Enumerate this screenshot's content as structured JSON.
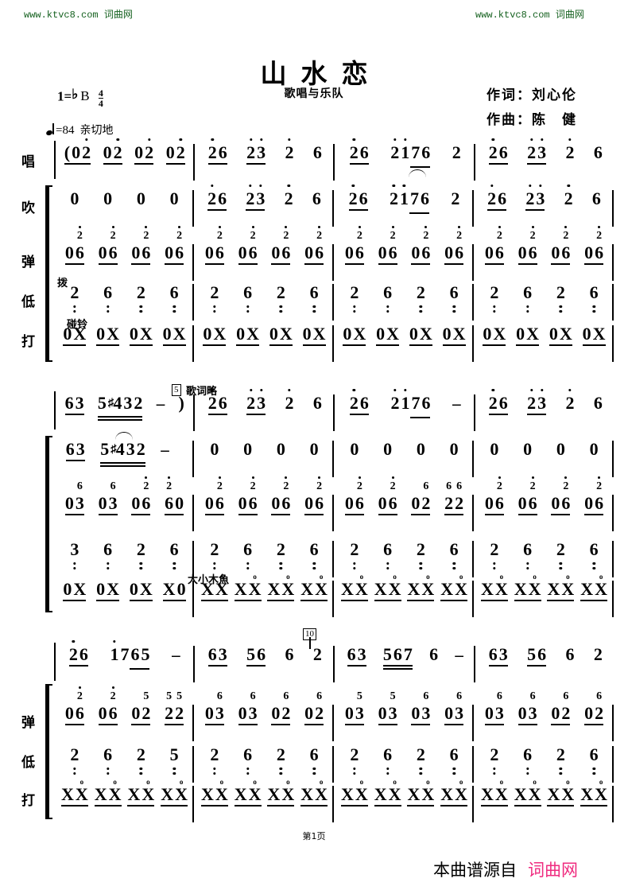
{
  "watermark": {
    "left": "www.ktvc8.com 词曲网",
    "right": "www.ktvc8.com 词曲网",
    "color": "#15611f"
  },
  "header": {
    "title": "山水恋",
    "subtitle": "歌唱与乐队",
    "lyricist": "作词：刘心伦",
    "composer": "作曲：陈　健"
  },
  "score_meta": {
    "key_prefix": "1=",
    "key_flat": "♭",
    "key_note": "B",
    "time_numerator": "4",
    "time_denominator": "4",
    "tempo_equals": "=84",
    "expression": "亲切地"
  },
  "staff_labels": {
    "sing": "唱",
    "blow": "吹",
    "pluck": "弹",
    "bass": "低",
    "perc": "打"
  },
  "annotations": {
    "bo": "拨",
    "pengling": "碰铃",
    "muyu": "大小木魚",
    "lyrics_omitted": "歌词略",
    "measure_5": "5",
    "measure_10": "10"
  },
  "footer": {
    "page": "第1页",
    "source_prefix": "本曲谱源自",
    "source_site": "词曲网",
    "source_color": "#ef2b7f"
  },
  "chart_data": {
    "type": "table",
    "title": "山水恋 — 简谱 (numbered musical notation)",
    "systems": [
      {
        "index": 1,
        "staves": [
          {
            "label": "唱",
            "measures": [
              "( 0 2· 0 2· 0 2· 0 2·",
              "2· 6 2· 3· 2· 6",
              "2· 6 2· 1· 7 6 2",
              "2· 6 2· 3· 2· 6"
            ]
          },
          {
            "label": "吹",
            "measures": [
              "0 0 0 0",
              "2· 6 2· 3· 2· 6",
              "2· 6 2· 1· 7 6 2",
              "2· 6 2· 3· 2· 6"
            ]
          },
          {
            "label": "弹",
            "measures": [
              "06 06 06 06 (上声部 2· 2· 2· 2·)",
              "06 06 06 06 (上声部 2· 2· 2· 2·)",
              "06 06 06 06 (上声部 2· 2· 2· 2·)",
              "06 06 06 06 (上声部 2· 2· 2· 2·)"
            ]
          },
          {
            "label": "低",
            "measures": [
              "2. 6. 2. 6.",
              "2. 6. 2. 6.",
              "2. 6. 2. 6.",
              "2. 6. 2. 6."
            ]
          },
          {
            "label": "打",
            "measures": [
              "0X 0X 0X 0X",
              "0X 0X 0X 0X",
              "0X 0X 0X 0X",
              "0X 0X 0X 0X"
            ]
          }
        ]
      },
      {
        "index": 2,
        "staves": [
          {
            "label": "唱",
            "measures": [
              "6 3 5 #4 3 2 — )",
              "2· 6 2· 3· 2· 6",
              "2· 6 2· 1· 7 6 —",
              "2· 6 2· 3· 2· 6"
            ]
          },
          {
            "label": "吹",
            "measures": [
              "6 3 5 #4 3 2 —",
              "0 0 0 0",
              "0 0 0 0",
              "0 0 0 0"
            ]
          },
          {
            "label": "弹",
            "measures": [
              "03 0 3 06 60 (上声部 6 6 2· 2·)",
              "06 06 06 06 (上声部 2· 2· 2· 2·)",
              "06 06 02 22 (上声部 2· 2· 6 6 6)",
              "06 06 06 06 (上声部 2· 2· 2· 2·)"
            ]
          },
          {
            "label": "低",
            "measures": [
              "3. 6. 2. 6.",
              "2. 6. 2. 6.",
              "2. 6. 2. 6.",
              "2. 6. 2. 6."
            ]
          },
          {
            "label": "打",
            "measures": [
              "0X 0 X 0X X0",
              "XX̥ XX̥ XX̥ XX̥",
              "XX̥ XX̥ XX̥ XX̥",
              "XX̥ XX̥ XX̥ XX̥"
            ]
          }
        ]
      },
      {
        "index": 3,
        "staves": [
          {
            "label": "",
            "measures": [
              "2· 6 1· 7 6 5 —",
              "6 3 5 6 6 2",
              "6 3 5 6 7 6 —",
              "6 3 5 6 6 2"
            ]
          },
          {
            "label": "弹",
            "measures": [
              "06 06 02 22 (上声部 2· 2· 5 5 5)",
              "03 03 02 02 (上声部 6 6 6 6)",
              "03 0 3 03 03 (上声部 5 5 6 6)",
              "03 03 02 02 (上声部 6 6 6 6)"
            ]
          },
          {
            "label": "低",
            "measures": [
              "2. 6. 2. 5.",
              "2. 6. 2. 6.",
              "2. 6. 2. 6.",
              "2. 6. 2. 6."
            ]
          },
          {
            "label": "打",
            "measures": [
              "XX̥ XX̥ XX̥ XX̥",
              "XX̥ XX̥ XX̥ XX̥",
              "XX̥ X X̥ XX̥ XX̥",
              "XX̥ XX̥ XX̥ XX̥"
            ]
          }
        ]
      }
    ]
  }
}
